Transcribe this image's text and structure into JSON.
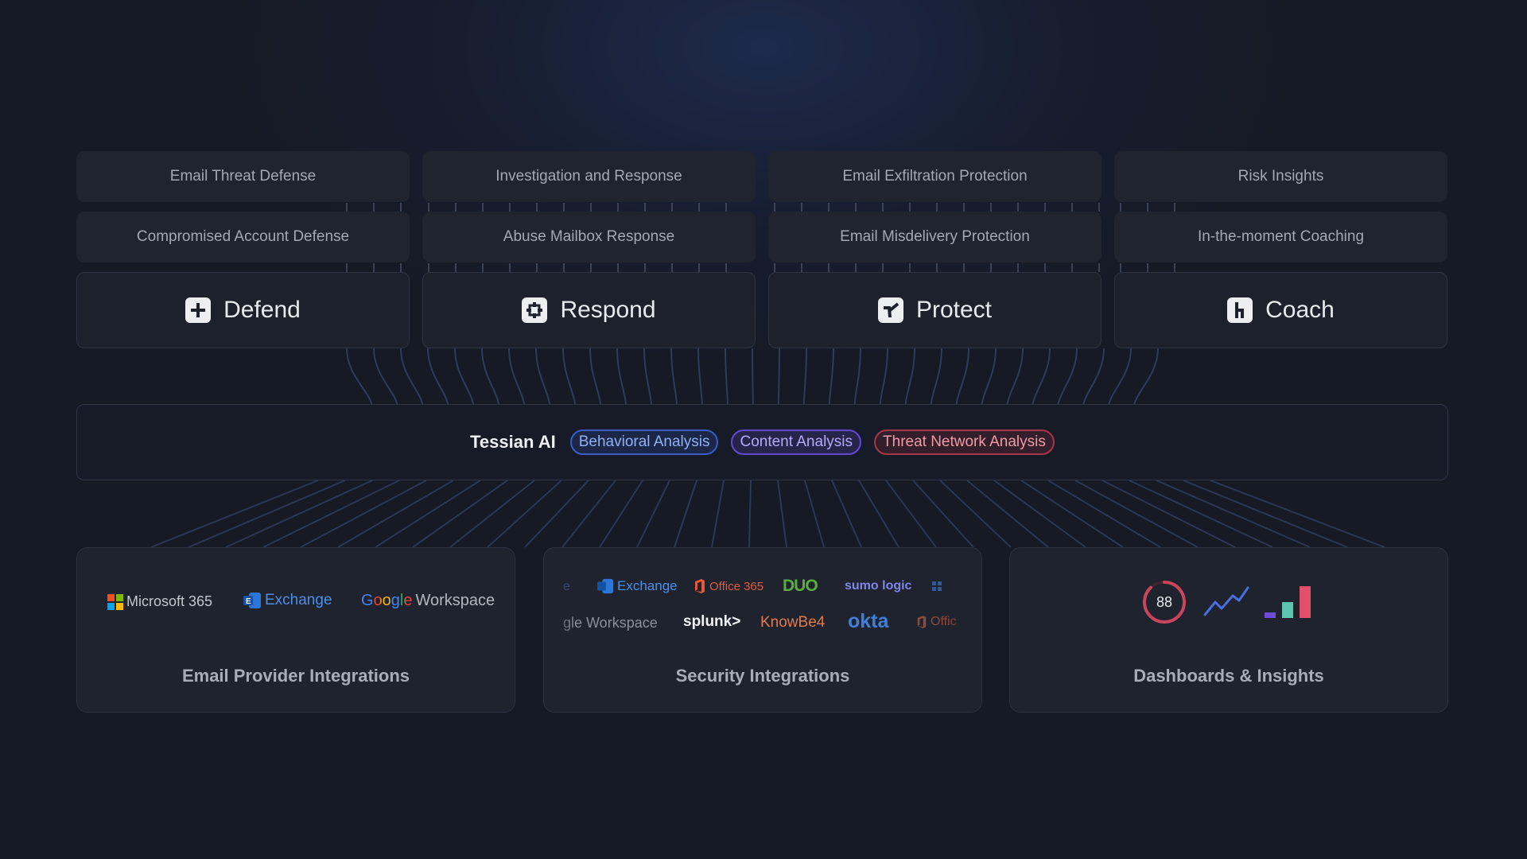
{
  "capabilities": [
    {
      "name": "Defend",
      "icon": "plus-square-icon",
      "features": [
        "Email Threat Defense",
        "Compromised Account Defense"
      ]
    },
    {
      "name": "Respond",
      "icon": "target-square-icon",
      "features": [
        "Investigation and Response",
        "Abuse Mailbox Response"
      ]
    },
    {
      "name": "Protect",
      "icon": "check-square-icon",
      "features": [
        "Email Exfiltration Protection",
        "Email Misdelivery Protection"
      ]
    },
    {
      "name": "Coach",
      "icon": "branch-square-icon",
      "features": [
        "Risk Insights",
        "In-the-moment Coaching"
      ]
    }
  ],
  "ai": {
    "title": "Tessian AI",
    "tags": [
      "Behavioral Analysis",
      "Content Analysis",
      "Threat Network Analysis"
    ]
  },
  "cards": {
    "email_providers": {
      "title": "Email Provider Integrations",
      "logos": [
        "Microsoft 365",
        "Exchange",
        "Google",
        "Workspace"
      ]
    },
    "security": {
      "title": "Security Integrations",
      "row1": [
        "e",
        "Exchange",
        "Office 365",
        "DUO",
        "sumo logic"
      ],
      "row2": [
        "gle Workspace",
        "splunk>",
        "KnowBe4",
        "okta",
        "Offic"
      ]
    },
    "dashboards": {
      "title": "Dashboards & Insights",
      "score": 88
    }
  },
  "colors": {
    "blue_tag": "#3b5cc9",
    "purple_tag": "#6149d0",
    "red_tag": "#a73648",
    "score_ring": "#c9445c",
    "bar_purple": "#6d4cd6",
    "bar_teal": "#5ec6b0",
    "bar_red": "#e0506b"
  }
}
